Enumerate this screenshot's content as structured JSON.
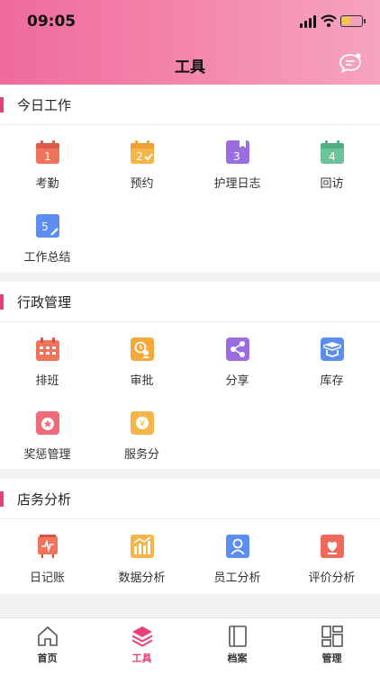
{
  "status": {
    "time": "09:05",
    "battery_level": 0.45
  },
  "header": {
    "title": "工具",
    "chat_icon": "chat-bubble-icon"
  },
  "colors": {
    "accent": "#e83e7a",
    "header_start": "#f06a9b",
    "header_end": "#f7a3c0"
  },
  "sections": {
    "today": {
      "title": "今日工作",
      "items": [
        {
          "label": "考勤",
          "icon": "calendar-1-icon"
        },
        {
          "label": "预约",
          "icon": "calendar-2-check-icon"
        },
        {
          "label": "护理日志",
          "icon": "bookmark-3-icon"
        },
        {
          "label": "回访",
          "icon": "calendar-4-icon"
        },
        {
          "label": "工作总结",
          "icon": "edit-5-icon"
        }
      ]
    },
    "admin": {
      "title": "行政管理",
      "items": [
        {
          "label": "排班",
          "icon": "schedule-icon"
        },
        {
          "label": "审批",
          "icon": "approval-icon"
        },
        {
          "label": "分享",
          "icon": "share-icon"
        },
        {
          "label": "库存",
          "icon": "inventory-icon"
        },
        {
          "label": "奖惩管理",
          "icon": "reward-icon"
        },
        {
          "label": "服务分",
          "icon": "service-score-icon"
        }
      ]
    },
    "analysis": {
      "title": "店务分析",
      "items": [
        {
          "label": "日记账",
          "icon": "journal-icon"
        },
        {
          "label": "数据分析",
          "icon": "bar-chart-icon"
        },
        {
          "label": "员工分析",
          "icon": "staff-icon"
        },
        {
          "label": "评价分析",
          "icon": "rating-icon"
        }
      ]
    }
  },
  "tabbar": {
    "items": [
      {
        "label": "首页",
        "icon": "home-icon"
      },
      {
        "label": "工具",
        "icon": "layers-icon"
      },
      {
        "label": "档案",
        "icon": "book-icon"
      },
      {
        "label": "管理",
        "icon": "dashboard-icon"
      }
    ]
  }
}
